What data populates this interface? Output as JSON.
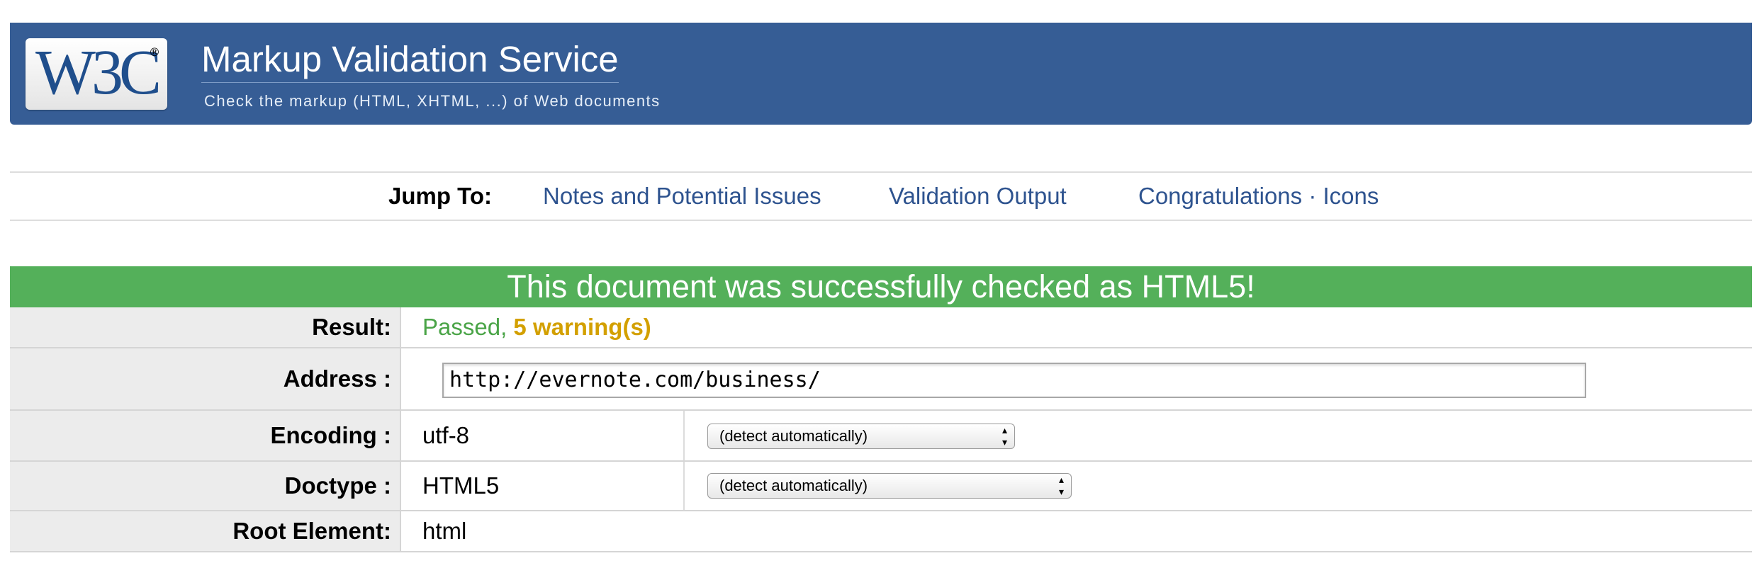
{
  "header": {
    "logo_text": "W3C",
    "logo_reg": "®",
    "title": "Markup Validation Service",
    "subtitle": "Check the markup (HTML, XHTML, ...) of Web documents"
  },
  "jumpbar": {
    "label": "Jump To:",
    "links": [
      "Notes and Potential Issues",
      "Validation Output",
      "Congratulations · Icons"
    ]
  },
  "result": {
    "heading": "This document was successfully checked as HTML5!",
    "rows": {
      "result_label": "Result:",
      "result_passed": "Passed,",
      "result_warnings": "5 warning(s)",
      "address_label": "Address :",
      "address_value": "http://evernote.com/business/",
      "encoding_label": "Encoding :",
      "encoding_value": "utf-8",
      "encoding_select": "(detect automatically)",
      "doctype_label": "Doctype :",
      "doctype_value": "HTML5",
      "doctype_select": "(detect automatically)",
      "root_label": "Root Element:",
      "root_value": "html"
    }
  },
  "colors": {
    "banner": "#365d95",
    "success": "#54b05a",
    "passed_text": "#4aa447",
    "warning_text": "#d3a000",
    "link": "#2e538f"
  },
  "icons": [
    "w3c-logo",
    "select-arrows-icon"
  ]
}
